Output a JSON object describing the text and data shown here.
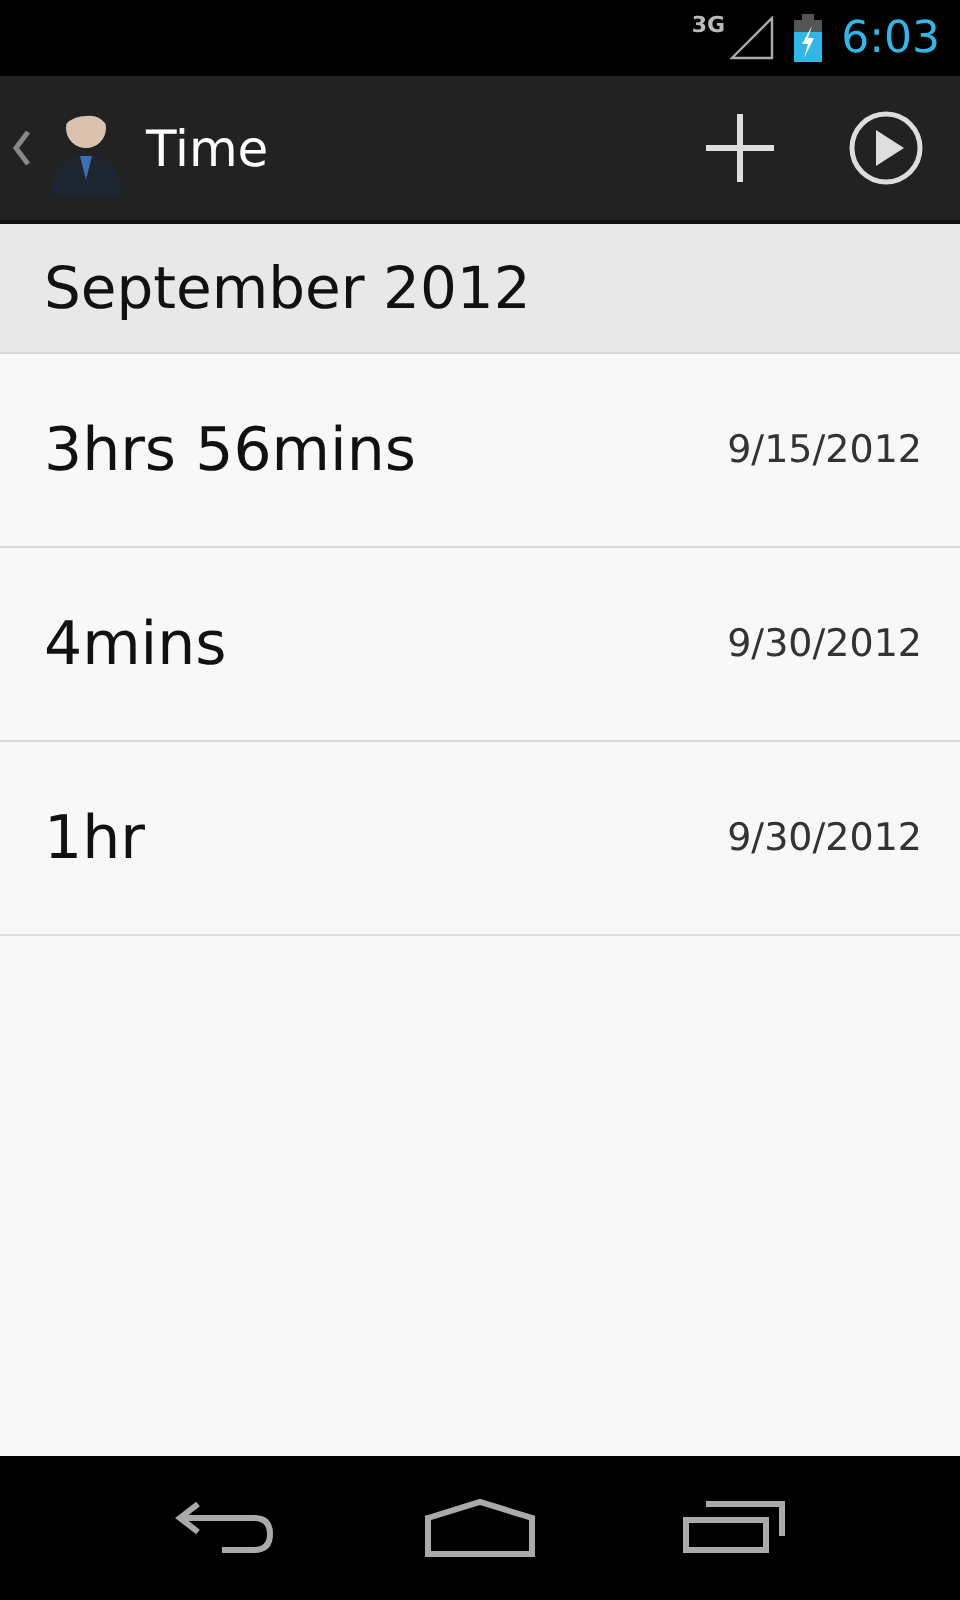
{
  "status_bar": {
    "network": "3G",
    "time": "6:03"
  },
  "action_bar": {
    "title": "Time"
  },
  "section": {
    "title": "September 2012"
  },
  "entries": [
    {
      "duration": "3hrs 56mins",
      "date": "9/15/2012"
    },
    {
      "duration": "4mins",
      "date": "9/30/2012"
    },
    {
      "duration": "1hr",
      "date": "9/30/2012"
    }
  ]
}
